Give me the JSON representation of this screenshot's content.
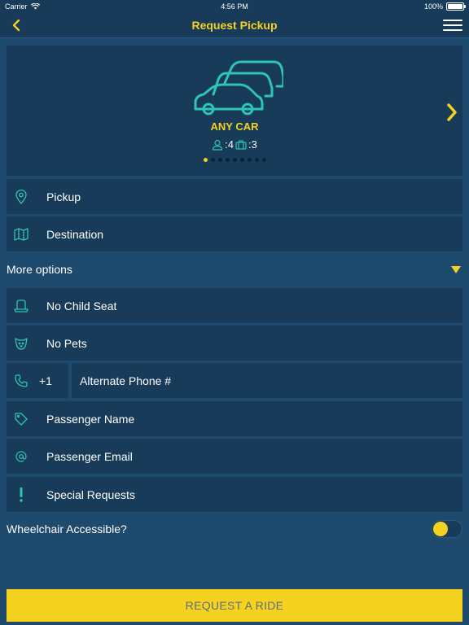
{
  "status_bar": {
    "carrier": "Carrier",
    "time": "4:56 PM",
    "battery": "100%"
  },
  "nav": {
    "title": "Request Pickup"
  },
  "car_selector": {
    "name": "ANY CAR",
    "passengers": ":4",
    "luggage": ":3",
    "page_count": 9,
    "active_page": 0
  },
  "rows": {
    "pickup": "Pickup",
    "destination": "Destination"
  },
  "more_options": {
    "label": "More options"
  },
  "options": {
    "child_seat": "No Child Seat",
    "pets": "No Pets",
    "phone_code": "+1",
    "phone_placeholder": "Alternate Phone #",
    "passenger_name": "Passenger Name",
    "passenger_email": "Passenger Email",
    "special_requests": "Special Requests"
  },
  "wheelchair": {
    "label": "Wheelchair Accessible?",
    "enabled": false
  },
  "request_button": {
    "label": "REQUEST A RIDE"
  },
  "colors": {
    "accent": "#f5d21f",
    "background": "#1e4a6e",
    "panel": "#173b59",
    "icon": "#2ec4b6"
  }
}
